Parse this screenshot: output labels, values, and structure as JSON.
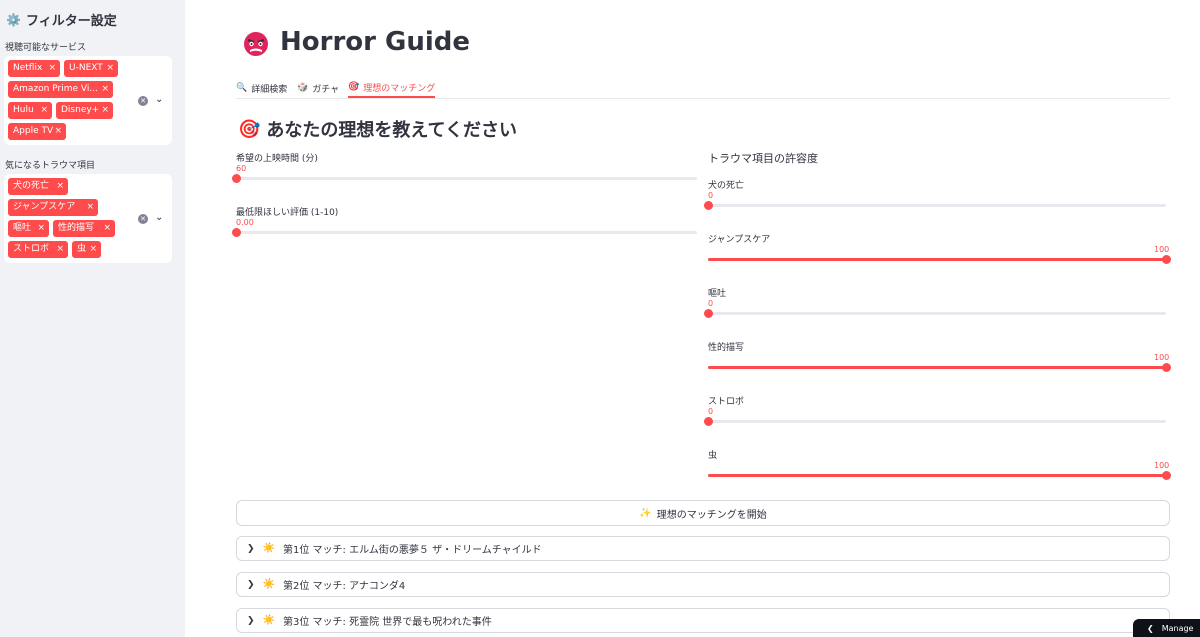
{
  "sidebar": {
    "title": "フィルター設定",
    "services": {
      "label": "視聴可能なサービス",
      "chips": [
        "Netflix",
        "U-NEXT",
        "Amazon Prime Vi...",
        "Hulu",
        "Disney+",
        "Apple TV"
      ]
    },
    "trauma": {
      "label": "気になるトラウマ項目",
      "chips": [
        "犬の死亡",
        "ジャンプスケア",
        "嘔吐",
        "性的描写",
        "ストロボ",
        "虫"
      ]
    },
    "chip_remove": "×",
    "clear_icon": "clear-icon",
    "chevron_icon": "chevron-down-icon"
  },
  "header": {
    "title": "Horror Guide"
  },
  "tabs": [
    {
      "label": "詳細検索",
      "icon": "🔍",
      "active": false
    },
    {
      "label": "ガチャ",
      "icon": "🎲",
      "active": false
    },
    {
      "label": "理想のマッチング",
      "icon": "🎯",
      "active": true
    }
  ],
  "main": {
    "section_title": "あなたの理想を教えてください",
    "left_sliders": [
      {
        "label": "希望の上映時間 (分)",
        "value_text": "60",
        "fraction": 0
      },
      {
        "label": "最低限ほしい評価 (1-10)",
        "value_text": "0.00",
        "fraction": 0
      }
    ],
    "trauma_title": "トラウマ項目の許容度",
    "trauma_sliders": [
      {
        "label": "犬の死亡",
        "value_text": "0",
        "fraction": 0
      },
      {
        "label": "ジャンプスケア",
        "value_text": "100",
        "fraction": 1
      },
      {
        "label": "嘔吐",
        "value_text": "0",
        "fraction": 0
      },
      {
        "label": "性的描写",
        "value_text": "100",
        "fraction": 1
      },
      {
        "label": "ストロボ",
        "value_text": "0",
        "fraction": 0
      },
      {
        "label": "虫",
        "value_text": "100",
        "fraction": 1
      }
    ],
    "match_button": "理想のマッチングを開始",
    "results": [
      "第1位 マッチ: エルム街の悪夢５ ザ・ドリームチャイルド",
      "第2位 マッチ: アナコンダ4",
      "第3位 マッチ: 死霊院 世界で最も呪われた事件"
    ]
  },
  "manage_label": "Manage",
  "colors": {
    "accent": "#ff4b4b",
    "sidebar_bg": "#f0f2f6",
    "text": "#31333f"
  }
}
